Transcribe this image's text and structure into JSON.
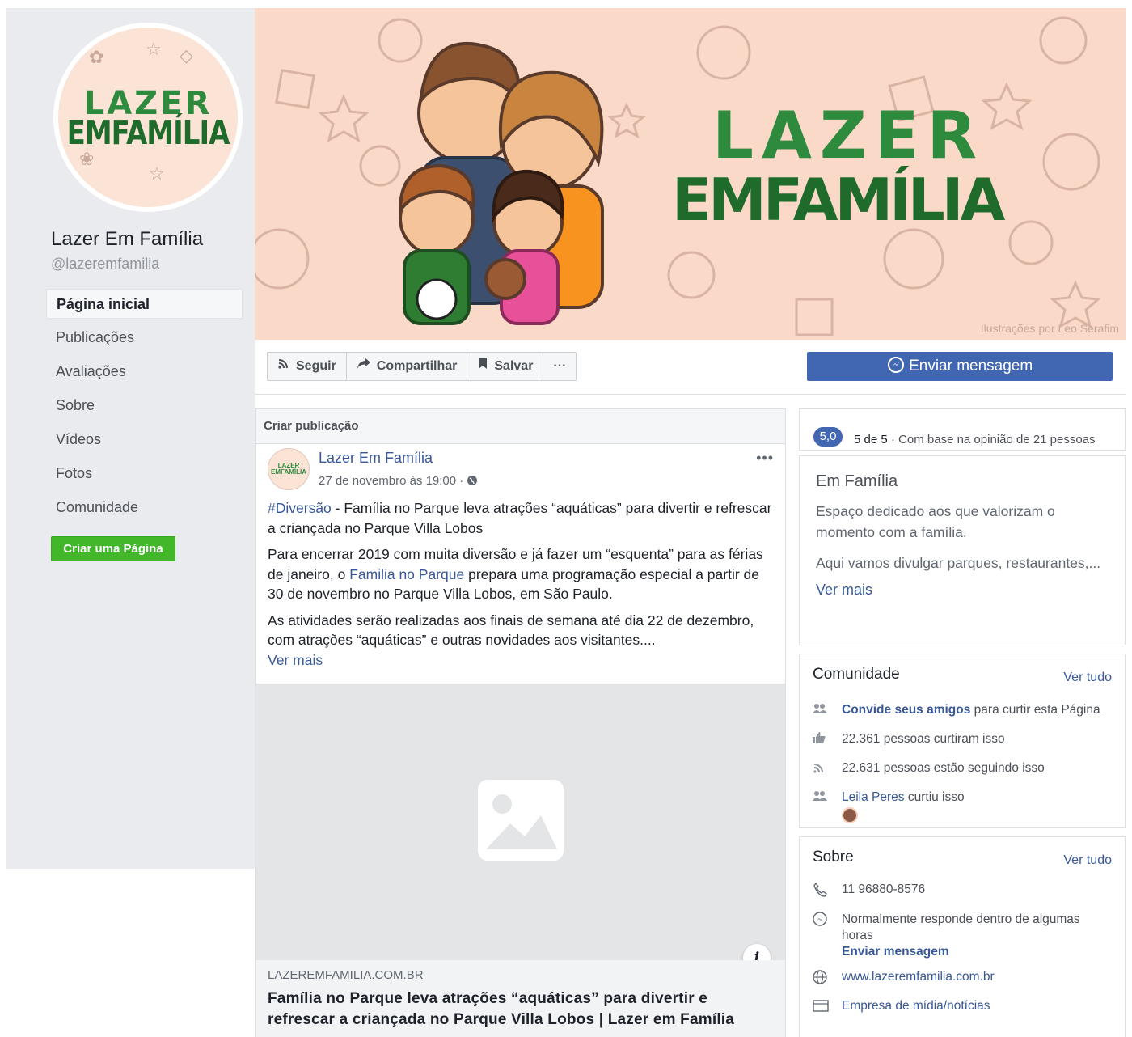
{
  "sidebar": {
    "logo_line1": "LAZER",
    "logo_line2": "EMFAMÍLIA",
    "page_name": "Lazer Em Família",
    "handle": "@lazeremfamilia",
    "nav": [
      "Página inicial",
      "Publicações",
      "Avaliações",
      "Sobre",
      "Vídeos",
      "Fotos",
      "Comunidade"
    ],
    "create_page": "Criar uma Página"
  },
  "cover": {
    "title_line1": "LAZER",
    "title_line2": "EMFAMÍLIA",
    "credit": "Ilustrações por Leo Serafim"
  },
  "actions": {
    "follow": "Seguir",
    "share": "Compartilhar",
    "save": "Salvar",
    "more": "···",
    "send_message": "Enviar mensagem"
  },
  "post": {
    "create_post": "Criar publicação",
    "author": "Lazer Em Família",
    "time": "27 de novembro às 19:00 ·",
    "hashtag": "#Diversão",
    "headline": " - Família no Parque leva atrações “aquáticas” para divertir e refrescar a criançada no Parque Villa Lobos",
    "para2_a": "Para encerrar 2019 com muita diversão e já fazer um “esquenta” para as férias de janeiro, o ",
    "para2_link": "Familia no Parque",
    "para2_b": " prepara uma programação especial a partir de 30 de novembro no Parque Villa Lobos, em São Paulo.",
    "para3": "As atividades serão realizadas aos finais de semana até dia 22 de dezembro, com atrações “aquáticas” e outras novidades aos visitantes....",
    "see_more": "Ver mais",
    "link_domain": "LAZEREMFAMILIA.COM.BR",
    "link_title": "Família no Parque leva atrações “aquáticas” para divertir e refrescar a criançada no Parque Villa Lobos | Lazer em Família"
  },
  "rating": {
    "score": "5,0",
    "of": "5 de 5",
    "basis": " · Com base na opinião de 21 pessoas"
  },
  "about": {
    "title": "Em Família",
    "p1": "Espaço dedicado aos que valorizam o momento com a família.",
    "p2": "Aqui vamos divulgar parques, restaurantes,...",
    "see_more": "Ver mais"
  },
  "community": {
    "title": "Comunidade",
    "see_all": "Ver tudo",
    "invite_link": "Convide seus amigos",
    "invite_rest": " para curtir esta Página",
    "likes": "22.361 pessoas curtiram isso",
    "follows": "22.631 pessoas estão seguindo isso",
    "friend": "Leila Peres",
    "friend_rest": " curtiu isso"
  },
  "sobre": {
    "title": "Sobre",
    "see_all": "Ver tudo",
    "phone": "11 96880-8576",
    "response": "Normalmente responde dentro de algumas horas",
    "send_message": "Enviar mensagem",
    "website": "www.lazeremfamilia.com.br",
    "category": "Empresa de mídia/notícias"
  }
}
